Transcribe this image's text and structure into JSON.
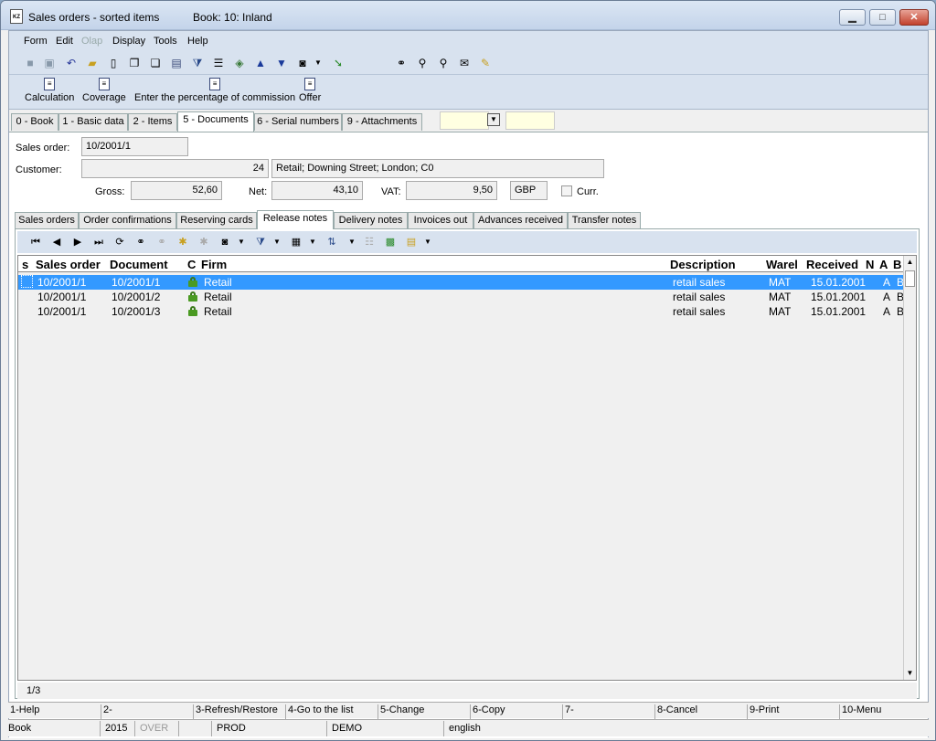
{
  "window": {
    "title": "Sales orders - sorted items",
    "book": "Book: 10: Inland",
    "app_icon": "KZ"
  },
  "menu": [
    "Form",
    "Edit",
    "Olap",
    "Display",
    "Tools",
    "Help"
  ],
  "toolbar2": [
    "Calculation",
    "Coverage",
    "Enter the percentage of commission",
    "Offer"
  ],
  "main_tabs": [
    "0 - Book",
    "1 - Basic data",
    "2 - Items",
    "5 - Documents",
    "6 - Serial numbers",
    "9 - Attachments"
  ],
  "form": {
    "sales_order_label": "Sales order:",
    "sales_order_value": "10/2001/1",
    "customer_label": "Customer:",
    "customer_number": "24",
    "customer_text": "Retail; Downing Street; London; C0",
    "gross_label": "Gross:",
    "gross_value": "52,60",
    "net_label": "Net:",
    "net_value": "43,10",
    "vat_label": "VAT:",
    "vat_value": "9,50",
    "currency": "GBP",
    "curr_label": "Curr."
  },
  "sub_tabs": [
    "Sales orders",
    "Order confirmations",
    "Reserving cards",
    "Release notes",
    "Delivery notes",
    "Invoices out",
    "Advances received",
    "Transfer notes"
  ],
  "grid": {
    "headers": [
      "s",
      "Sales order",
      "Document",
      "C",
      "Firm",
      "Description",
      "Warel",
      "Received",
      "N",
      "A",
      "B"
    ],
    "rows": [
      {
        "sales_order": "10/2001/1",
        "document": "10/2001/1",
        "firm": "Retail",
        "description": "retail sales",
        "warehouse": "MAT",
        "received": "15.01.2001",
        "a": "A",
        "b": "B"
      },
      {
        "sales_order": "10/2001/1",
        "document": "10/2001/2",
        "firm": "Retail",
        "description": "retail sales",
        "warehouse": "MAT",
        "received": "15.01.2001",
        "a": "A",
        "b": "B"
      },
      {
        "sales_order": "10/2001/1",
        "document": "10/2001/3",
        "firm": "Retail",
        "description": "retail sales",
        "warehouse": "MAT",
        "received": "15.01.2001",
        "a": "A",
        "b": "B"
      }
    ],
    "position": "1/3"
  },
  "fkeys": [
    "1-Help",
    "2-",
    "3-Refresh/Restore",
    "4-Go to the list",
    "5-Change",
    "6-Copy",
    "7-",
    "8-Cancel",
    "9-Print",
    "10-Menu"
  ],
  "status": {
    "mode": "Book",
    "year": "2015",
    "over": "OVER",
    "db": "PROD",
    "company": "DEMO",
    "language": "english"
  }
}
